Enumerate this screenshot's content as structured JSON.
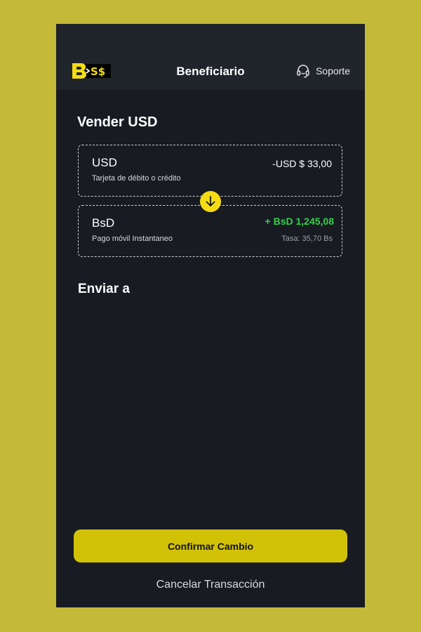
{
  "header": {
    "title": "Beneficiario",
    "support_label": "Soporte",
    "logo_text": "B>S$"
  },
  "sell": {
    "title": "Vender USD",
    "from": {
      "currency": "USD",
      "method": "Tarjeta de débito o crédito",
      "amount": "-USD $ 33,00"
    },
    "to": {
      "currency": "BsD",
      "method": "Pago móvil Instantaneo",
      "amount": "+ BsD 1,245,08",
      "rate": "Tasa: 35,70 Bs"
    }
  },
  "send_to": {
    "title": "Enviar a"
  },
  "actions": {
    "confirm_label": "Confirmar Cambio",
    "cancel_label": "Cancelar Transacción"
  },
  "colors": {
    "background": "#c4b938",
    "screen": "#181b22",
    "header": "#20242b",
    "accent_yellow": "#f5dc13",
    "button_yellow": "#d1c207",
    "positive_green": "#33d14a"
  },
  "icons": {
    "logo": "boss-logo",
    "support": "headset-icon",
    "swap": "arrow-down-icon"
  }
}
